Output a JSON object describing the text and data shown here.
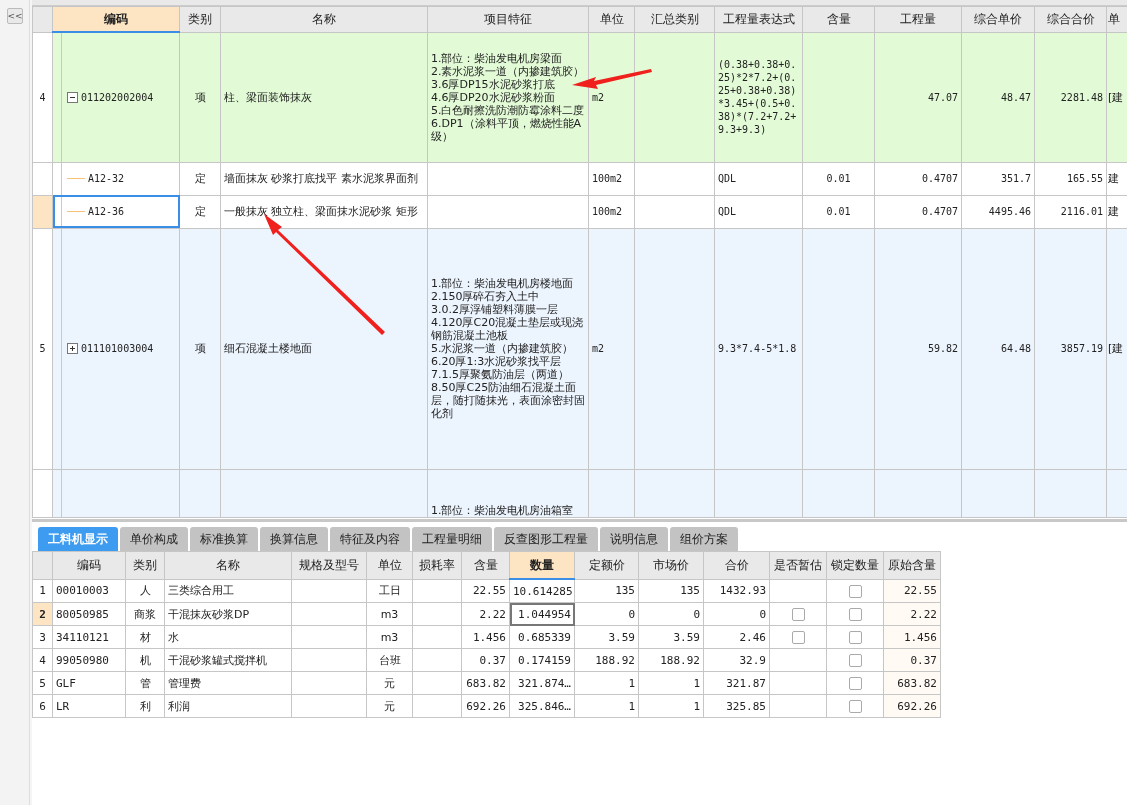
{
  "sidebar": {
    "collapse_button": "<<"
  },
  "grid": {
    "columns": [
      {
        "selected": false
      },
      {
        "label": "编码",
        "selected": true
      },
      {
        "label": "类别",
        "selected": false
      },
      {
        "label": "名称",
        "selected": false
      },
      {
        "label": "项目特征",
        "selected": false
      },
      {
        "label": "单位",
        "selected": false
      },
      {
        "label": "汇总类别",
        "selected": false
      },
      {
        "label": "工程量表达式",
        "selected": false
      },
      {
        "label": "含量",
        "selected": false
      },
      {
        "label": "工程量",
        "selected": false
      },
      {
        "label": "综合单价",
        "selected": false
      },
      {
        "label": "综合合价",
        "selected": false
      },
      {
        "label": "单",
        "selected": false
      }
    ],
    "rows": [
      {
        "number": "4",
        "code": "011202002004",
        "type": "项",
        "name": "柱、梁面装饰抹灰",
        "features": [
          "1.部位：柴油发电机房梁面",
          "2.素水泥浆一道（内掺建筑胶）",
          "3.6厚DP15水泥砂浆打底",
          "4.6厚DP20水泥砂浆粉面",
          "5.白色耐擦洗防潮防霉涂料二度",
          "6.DP1（涂料平顶，燃烧性能A级）"
        ],
        "unit": "m2",
        "expression": "(0.38+0.38+0.25)*2*7.2+(0.25+0.38+0.38)*3.45+(0.5+0.38)*(7.2+7.2+9.3+9.3)",
        "quantity": "47.07",
        "unit_price": "48.47",
        "total": "2281.48",
        "column_13": "[建",
        "expanded": true,
        "highlighted": true,
        "selected": false,
        "children": [
          {
            "code": "A12-32",
            "type": "定",
            "name": "墙面抹灰 砂浆打底找平 素水泥浆界面剂",
            "unit": "100m2",
            "expression": "QDL",
            "content": "0.01",
            "quantity": "0.4707",
            "unit_price": "351.7",
            "total": "165.55",
            "column_13": "建",
            "selected": false
          },
          {
            "code": "A12-36",
            "type": "定",
            "name": "一般抹灰 独立柱、梁面抹水泥砂浆 矩形",
            "unit": "100m2",
            "expression": "QDL",
            "content": "0.01",
            "quantity": "0.4707",
            "unit_price": "4495.46",
            "total": "2116.01",
            "column_13": "建",
            "selected": true
          }
        ]
      },
      {
        "number": "5",
        "code": "011101003004",
        "type": "项",
        "name": "细石混凝土楼地面",
        "features": [
          "1.部位：柴油发电机房楼地面",
          "2.150厚碎石夯入土中",
          "3.0.2厚浮铺塑料薄膜一层",
          "4.120厚C20混凝土垫层或现浇钢筋混凝土池板",
          "5.水泥浆一道（内掺建筑胶）",
          "6.20厚1:3水泥砂浆找平层",
          "7.1.5厚聚氨防油层（两道）",
          "8.50厚C25防油细石混凝土面层，随打随抹光，表面涂密封固化剂"
        ],
        "unit": "m2",
        "expression": "9.3*7.4-5*1.8",
        "quantity": "59.82",
        "unit_price": "64.48",
        "total": "3857.19",
        "column_13": "[建",
        "expanded": false,
        "highlighted": false,
        "selected": false
      },
      {
        "features": [
          "1.部位：柴油发电机房油箱室"
        ],
        "highlighted": false,
        "selected": false
      }
    ]
  },
  "tabs": [
    {
      "label": "工料机显示",
      "selected": true
    },
    {
      "label": "单价构成",
      "selected": false
    },
    {
      "label": "标准换算",
      "selected": false
    },
    {
      "label": "换算信息",
      "selected": false
    },
    {
      "label": "特征及内容",
      "selected": false
    },
    {
      "label": "工程量明细",
      "selected": false
    },
    {
      "label": "反查图形工程量",
      "selected": false
    },
    {
      "label": "说明信息",
      "selected": false
    },
    {
      "label": "组价方案",
      "selected": false
    }
  ],
  "resources": {
    "columns": [
      {
        "selected": false
      },
      {
        "label": "编码",
        "selected": false
      },
      {
        "label": "类别",
        "selected": false
      },
      {
        "label": "名称",
        "selected": false
      },
      {
        "label": "规格及型号",
        "selected": false
      },
      {
        "label": "单位",
        "selected": false
      },
      {
        "label": "损耗率",
        "selected": false
      },
      {
        "label": "含量",
        "selected": false
      },
      {
        "label": "数量",
        "selected": true
      },
      {
        "label": "定额价",
        "selected": false
      },
      {
        "label": "市场价",
        "selected": false
      },
      {
        "label": "合价",
        "selected": false
      },
      {
        "label": "是否暂估",
        "selected": false
      },
      {
        "label": "锁定数量",
        "selected": false
      },
      {
        "label": "原始含量",
        "selected": false
      }
    ],
    "rows": [
      {
        "number": "1",
        "code": "00010003",
        "type": "人",
        "name": "三类综合用工",
        "unit": "工日",
        "content": "22.55",
        "amount": "10.614285",
        "base_price": "135",
        "market_price": "135",
        "total": "1432.93",
        "locked": {
          "checked": false
        },
        "original_content": "22.55",
        "selected": false
      },
      {
        "number": "2",
        "code": "80050985",
        "type": "商浆",
        "name": "干混抹灰砂浆DP",
        "unit": "m3",
        "content": "2.22",
        "amount": "1.044954",
        "base_price": "0",
        "market_price": "0",
        "total": "0",
        "estimate": {
          "checked": false
        },
        "locked": {
          "checked": false
        },
        "original_content": "2.22",
        "selected": true
      },
      {
        "number": "3",
        "code": "34110121",
        "type": "材",
        "name": "水",
        "unit": "m3",
        "content": "1.456",
        "amount": "0.685339",
        "base_price": "3.59",
        "market_price": "3.59",
        "total": "2.46",
        "estimate": {
          "checked": false
        },
        "locked": {
          "checked": false
        },
        "original_content": "1.456",
        "selected": false
      },
      {
        "number": "4",
        "code": "99050980",
        "type": "机",
        "name": "干混砂浆罐式搅拌机",
        "unit": "台班",
        "content": "0.37",
        "amount": "0.174159",
        "base_price": "188.92",
        "market_price": "188.92",
        "total": "32.9",
        "locked": {
          "checked": false
        },
        "original_content": "0.37",
        "selected": false
      },
      {
        "number": "5",
        "code": "GLF",
        "type": "管",
        "name": "管理费",
        "unit": "元",
        "content": "683.82",
        "amount": "321.874…",
        "base_price": "1",
        "market_price": "1",
        "total": "321.87",
        "locked": {
          "checked": false
        },
        "original_content": "683.82",
        "selected": false
      },
      {
        "number": "6",
        "code": "LR",
        "type": "利",
        "name": "利润",
        "unit": "元",
        "content": "692.26",
        "amount": "325.846…",
        "base_price": "1",
        "market_price": "1",
        "total": "325.85",
        "locked": {
          "checked": false
        },
        "original_content": "692.26",
        "selected": false
      }
    ]
  }
}
